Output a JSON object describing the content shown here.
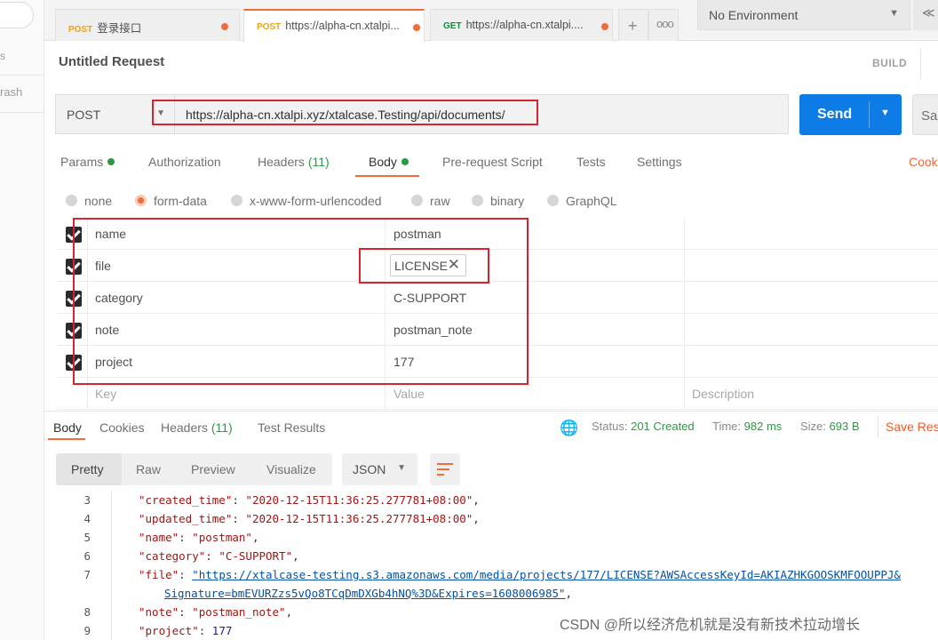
{
  "left_strip": {
    "fragment1": "s",
    "fragment2": "rash"
  },
  "tabs": [
    {
      "method": "POST",
      "label": "登录接口",
      "modified": true
    },
    {
      "method": "POST",
      "label": "https://alpha-cn.xtalpi...",
      "modified": true,
      "active": true
    },
    {
      "method": "GET",
      "label": "https://alpha-cn.xtalpi....",
      "modified": true
    }
  ],
  "tab_actions": {
    "add": "+",
    "more": "ooo"
  },
  "environment": {
    "selected": "No Environment"
  },
  "request": {
    "title": "Untitled Request",
    "build_label": "BUILD",
    "method": "POST",
    "url": "https://alpha-cn.xtalpi.xyz/xtalcase.Testing/api/documents/",
    "send_label": "Send",
    "save_label": "Sa"
  },
  "request_tabs": {
    "params": "Params",
    "authorization": "Authorization",
    "headers": "Headers",
    "headers_count": "(11)",
    "body": "Body",
    "prerequest": "Pre-request Script",
    "tests": "Tests",
    "settings": "Settings",
    "cookies": "Cook"
  },
  "body_types": [
    "none",
    "form-data",
    "x-www-form-urlencoded",
    "raw",
    "binary",
    "GraphQL"
  ],
  "body_type_selected": "form-data",
  "form_rows": [
    {
      "key": "name",
      "value": "postman"
    },
    {
      "key": "file",
      "value": "LICENSE",
      "is_file": true
    },
    {
      "key": "category",
      "value": "C-SUPPORT"
    },
    {
      "key": "note",
      "value": "postman_note"
    },
    {
      "key": "project",
      "value": "177"
    }
  ],
  "form_placeholders": {
    "key": "Key",
    "value": "Value",
    "description": "Description"
  },
  "response_tabs": {
    "body": "Body",
    "cookies": "Cookies",
    "headers": "Headers",
    "headers_count": "(11)",
    "tests": "Test Results"
  },
  "response_status": {
    "status_label": "Status:",
    "status": "201 Created",
    "time_label": "Time:",
    "time": "982 ms",
    "size_label": "Size:",
    "size": "693 B",
    "save": "Save Res"
  },
  "viewer": {
    "modes": [
      "Pretty",
      "Raw",
      "Preview",
      "Visualize"
    ],
    "active_mode": "Pretty",
    "format": "JSON"
  },
  "code_lines": [
    {
      "n": "3",
      "key": "\"created_time\"",
      "sep": ": ",
      "val": "\"2020-12-15T11:36:25.277781+08:00\"",
      "end": ","
    },
    {
      "n": "4",
      "key": "\"updated_time\"",
      "sep": ": ",
      "val": "\"2020-12-15T11:36:25.277781+08:00\"",
      "end": ","
    },
    {
      "n": "5",
      "key": "\"name\"",
      "sep": ": ",
      "val": "\"postman\"",
      "end": ","
    },
    {
      "n": "6",
      "key": "\"category\"",
      "sep": ": ",
      "val": "\"C-SUPPORT\"",
      "end": ","
    },
    {
      "n": "7",
      "key": "\"file\"",
      "sep": ": ",
      "val": "\"https://xtalcase-testing.s3.amazonaws.com/media/projects/177/LICENSE?AWSAccessKeyId=AKIAZHKGOOSKMFOOUPPJ&",
      "end": ""
    },
    {
      "n": "",
      "key": "",
      "sep": "",
      "val": "Signature=bmEVURZzs5vQo8TCqDmDXGb4hNQ%3D&Expires=1608006985\"",
      "end": ","
    },
    {
      "n": "8",
      "key": "\"note\"",
      "sep": ": ",
      "val": "\"postman_note\"",
      "end": ","
    },
    {
      "n": "9",
      "key": "\"project\"",
      "sep": ": ",
      "val": "177",
      "end": ""
    }
  ],
  "watermark": "CSDN @所以经济危机就是没有新技术拉动增长",
  "colors": {
    "accent": "#f26b3a",
    "send": "#0e7ce6",
    "success": "#2c9a44",
    "annotation": "#d9232e"
  }
}
